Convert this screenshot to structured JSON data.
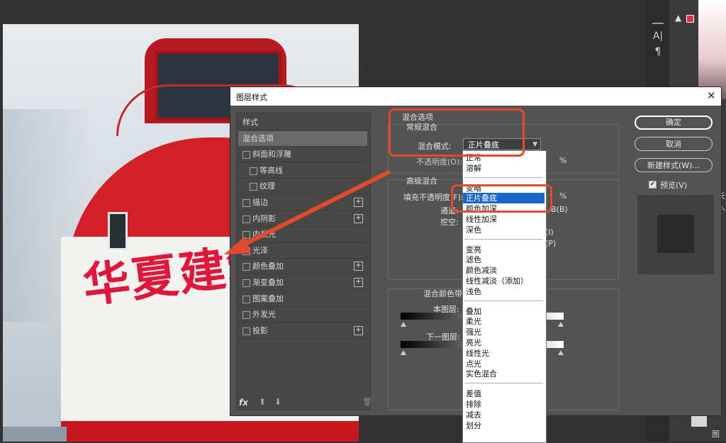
{
  "canvas": {
    "text_overlay": "华夏建筑"
  },
  "right_panel": {
    "tool_labels": [
      "A|",
      "¶"
    ],
    "side_chars": [
      "长",
      "人",
      "图"
    ]
  },
  "dialog": {
    "title": "图层样式",
    "close_label": "✕",
    "styles_list": [
      {
        "label": "样式",
        "checkbox": false,
        "plus": false,
        "indent": false,
        "selected": false
      },
      {
        "label": "混合选项",
        "checkbox": false,
        "plus": false,
        "indent": false,
        "selected": true
      },
      {
        "label": "斜面和浮雕",
        "checkbox": true,
        "plus": false,
        "indent": false,
        "selected": false
      },
      {
        "label": "等高线",
        "checkbox": true,
        "plus": false,
        "indent": true,
        "selected": false
      },
      {
        "label": "纹理",
        "checkbox": true,
        "plus": false,
        "indent": true,
        "selected": false
      },
      {
        "label": "描边",
        "checkbox": true,
        "plus": true,
        "indent": false,
        "selected": false
      },
      {
        "label": "内阴影",
        "checkbox": true,
        "plus": true,
        "indent": false,
        "selected": false
      },
      {
        "label": "内发光",
        "checkbox": true,
        "plus": false,
        "indent": false,
        "selected": false
      },
      {
        "label": "光泽",
        "checkbox": true,
        "plus": false,
        "indent": false,
        "selected": false
      },
      {
        "label": "颜色叠加",
        "checkbox": true,
        "plus": true,
        "indent": false,
        "selected": false
      },
      {
        "label": "渐变叠加",
        "checkbox": true,
        "plus": true,
        "indent": false,
        "selected": false
      },
      {
        "label": "图案叠加",
        "checkbox": true,
        "plus": false,
        "indent": false,
        "selected": false
      },
      {
        "label": "外发光",
        "checkbox": true,
        "plus": false,
        "indent": false,
        "selected": false
      },
      {
        "label": "投影",
        "checkbox": true,
        "plus": true,
        "indent": false,
        "selected": false
      }
    ],
    "footer": {
      "fx": "fx",
      "up": "⬆",
      "down": "⬇",
      "trash": "🗑"
    },
    "blend_options": {
      "section_title": "混合选项",
      "general_title": "常规混合",
      "blend_mode_label": "混合模式:",
      "blend_mode_value": "正片叠底",
      "opacity_label": "不透明度(O):",
      "opacity_unit": "%",
      "advanced_title": "高级混合",
      "fill_opacity_label": "填充不透明度(F):",
      "fill_unit": "%",
      "channels_label": "通道:",
      "channel_b": "B(B)",
      "knockout_label": "挖空:",
      "knockout_suffix_1": "(I)",
      "knockout_suffix_2": "(P)",
      "blend_if_label": "混合颜色带:",
      "this_layer_label": "本图层:",
      "underlying_label": "下一图层:"
    },
    "buttons": {
      "ok": "确定",
      "cancel": "取消",
      "new_style": "新建样式(W)...",
      "preview_label": "预览(V)",
      "preview_checked": true
    },
    "dropdown": {
      "selected": "正片叠底",
      "groups": [
        [
          "正常",
          "溶解"
        ],
        [
          "变暗",
          "正片叠底",
          "颜色加深",
          "线性加深",
          "深色"
        ],
        [
          "变亮",
          "滤色",
          "颜色减淡",
          "线性减淡（添加）",
          "浅色"
        ],
        [
          "叠加",
          "柔光",
          "强光",
          "亮光",
          "线性光",
          "点光",
          "实色混合"
        ],
        [
          "差值",
          "排除",
          "减去",
          "划分"
        ]
      ]
    }
  },
  "colors": {
    "accent_highlight": "#e24a2e",
    "dropdown_selection": "#1b66c9"
  }
}
